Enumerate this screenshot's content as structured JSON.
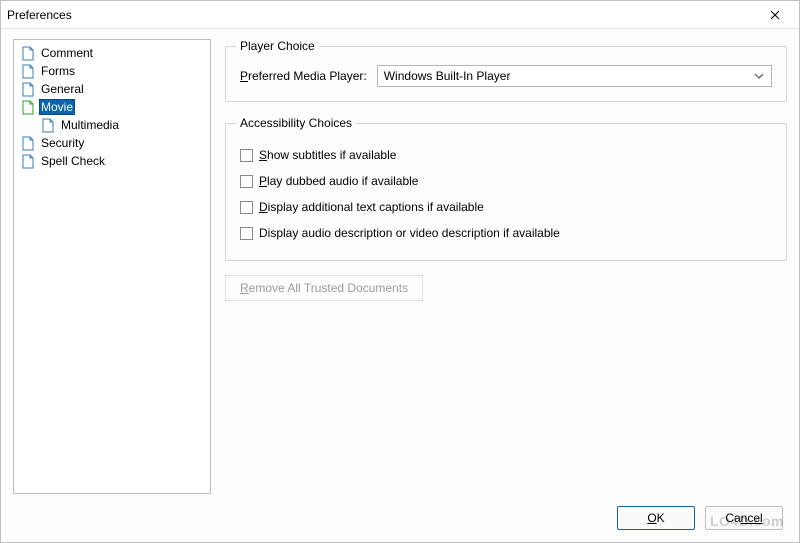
{
  "window": {
    "title": "Preferences"
  },
  "sidebar": {
    "items": [
      {
        "label": "Comment"
      },
      {
        "label": "Forms"
      },
      {
        "label": "General"
      },
      {
        "label": "Movie",
        "selected": true
      },
      {
        "label": "Multimedia",
        "child": true
      },
      {
        "label": "Security"
      },
      {
        "label": "Spell Check"
      }
    ]
  },
  "panels": {
    "playerChoice": {
      "legend": "Player Choice",
      "preferredLabel_pre": "P",
      "preferredLabel_post": "referred Media Player:",
      "preferredValue": "Windows Built-In Player"
    },
    "accessibility": {
      "legend": "Accessibility Choices",
      "opt1_pre": "S",
      "opt1_post": "how subtitles if available",
      "opt2_pre": "P",
      "opt2_post": "lay dubbed audio if available",
      "opt3_pre": "D",
      "opt3_post": "isplay additional text captions if available",
      "opt4": "Display audio description or video description if available"
    },
    "removeTrusted_pre": "R",
    "removeTrusted_post": "emove All Trusted Documents"
  },
  "footer": {
    "ok_pre": "O",
    "ok_post": "K",
    "cancel_pre": "Ca",
    "cancel_post": "ncel"
  },
  "watermark": "LO4D.com"
}
